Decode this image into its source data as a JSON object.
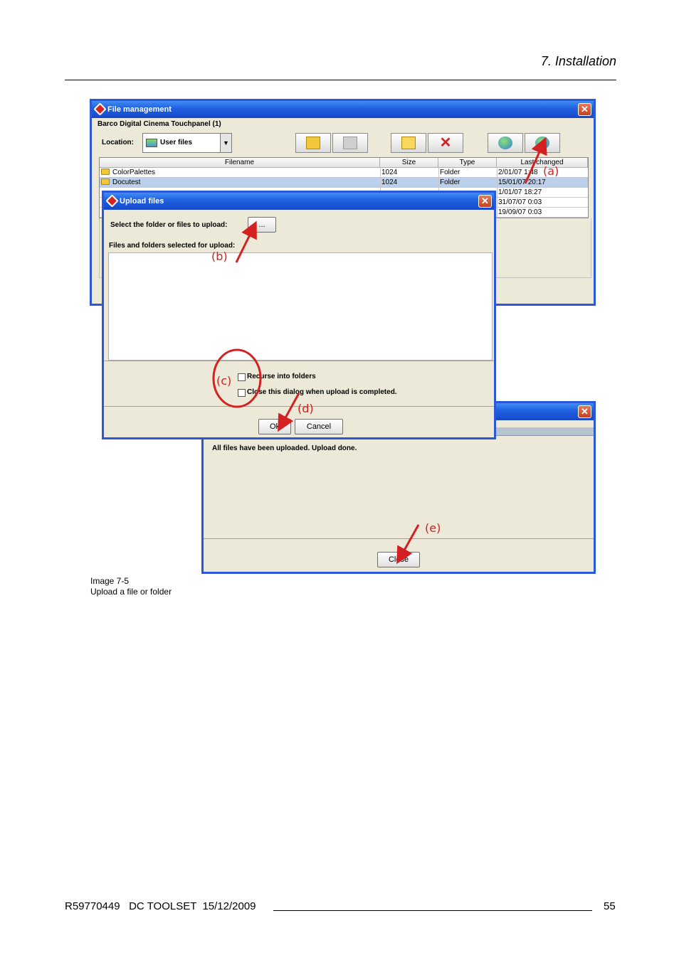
{
  "header": {
    "section": "7.  Installation"
  },
  "file_management": {
    "title": "File management",
    "device": "Barco Digital Cinema Touchpanel (1)",
    "location_label": "Location:",
    "location_value": "User files",
    "columns": [
      "Filename",
      "Size",
      "Type",
      "Last changed"
    ],
    "rows": [
      {
        "name": "ColorPalettes",
        "size": "1024",
        "type": "Folder",
        "changed": "2/01/07 1:48"
      },
      {
        "name": "Docutest",
        "size": "1024",
        "type": "Folder",
        "changed": "15/01/07 20:17"
      },
      {
        "name": "",
        "size": "",
        "type": "",
        "changed": "1/01/07 18:27"
      },
      {
        "name": "",
        "size": "",
        "type": "",
        "changed": "31/07/07 0:03"
      },
      {
        "name": "",
        "size": "",
        "type": "",
        "changed": "19/09/07 0:03"
      }
    ]
  },
  "upload_files": {
    "title": "Upload files",
    "select_label": "Select the folder or files to upload:",
    "browse_label": "...",
    "selected_label": "Files and folders selected for upload:",
    "recurse_label": "Recurse into folders",
    "close_when_done_label": "Close this dialog when upload is completed.",
    "ok_label": "Ok",
    "cancel_label": "Cancel"
  },
  "upload_done": {
    "message": "All files have been uploaded. Upload done.",
    "close_label": "Close"
  },
  "annotations": {
    "a": "(a)",
    "b": "(b)",
    "c": "(c)",
    "d": "(d)",
    "e": "(e)"
  },
  "caption": {
    "number": "Image 7-5",
    "text": "Upload a file or folder"
  },
  "footer": {
    "doc": "R59770449   DC TOOLSET  15/12/2009",
    "page": "55"
  },
  "colors": {
    "title_bar": "#1f5fe0",
    "annotation": "#d42020",
    "selected_row": "#bcd0ec"
  }
}
